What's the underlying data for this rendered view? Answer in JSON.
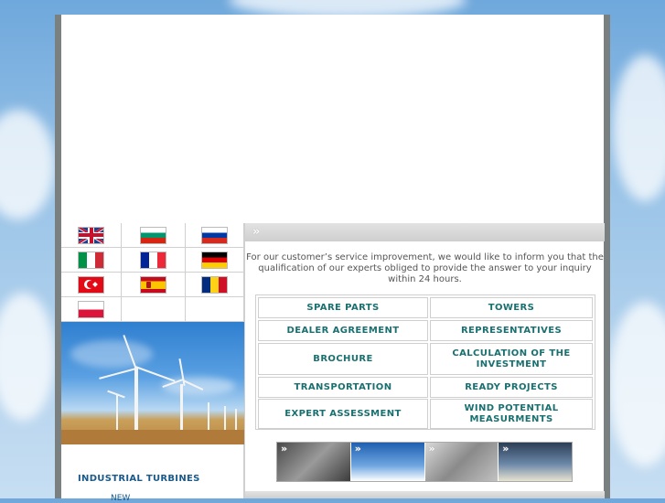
{
  "flags": [
    {
      "name": "uk-flag"
    },
    {
      "name": "bulgaria-flag"
    },
    {
      "name": "russia-flag"
    },
    {
      "name": "italy-flag"
    },
    {
      "name": "france-flag"
    },
    {
      "name": "germany-flag"
    },
    {
      "name": "turkey-flag"
    },
    {
      "name": "spain-flag"
    },
    {
      "name": "romania-flag"
    },
    {
      "name": "poland-flag"
    }
  ],
  "notice": "For our customer’s service improvement, we would like to inform you that the qualification of our experts obliged to provide the answer to your inquiry within 24 hours.",
  "buttons": {
    "spare_parts": "SPARE PARTS",
    "towers": "TOWERS",
    "dealer_agreement": "DEALER AGREEMENT",
    "representatives": "REPRESENTATIVES",
    "brochure": "BROCHURE",
    "calculation": "CALCULATION OF THE INVESTMENT",
    "transportation": "TRANSPORTATION",
    "ready_projects": "READY PROJECTS",
    "expert_assessment": "EXPERT ASSESSMENT",
    "wind_potential": "WIND POTENTIAL MEASURMENTS"
  },
  "sidebar": {
    "heading": "INDUSTRIAL TURBINES",
    "link": "NEW"
  },
  "chevron": "»",
  "colors": {
    "accent": "#1a7070",
    "heading": "#1a5a8a",
    "bar": "#d8d8d8"
  }
}
